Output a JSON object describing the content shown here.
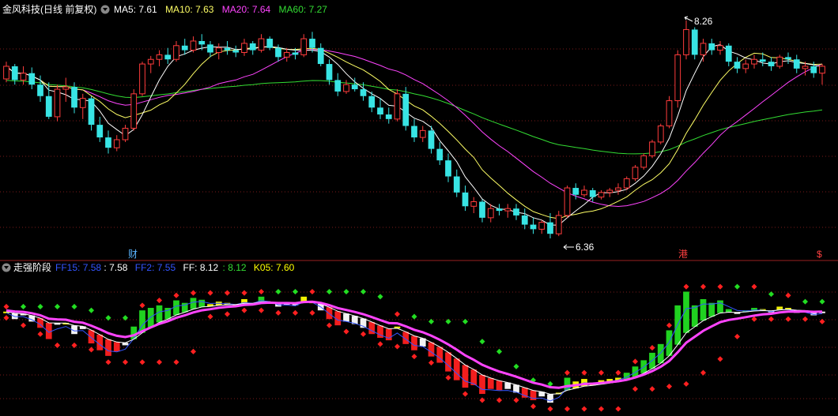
{
  "colors": {
    "bg": "#000000",
    "grid": "#7a1a1a",
    "up": "#ff3c3c",
    "down": "#38e4e4",
    "ma5": "#ffffff",
    "ma10": "#ffff66",
    "ma20": "#ff44ff",
    "ma60": "#33dd33",
    "title": "#ffffff",
    "ff15": "#3355ff",
    "ff2": "#3355ff",
    "ff": "#ffffff",
    "k05": "#ffff00"
  },
  "top_panel": {
    "title": "金风科技(日线 前复权)",
    "indicators": [
      {
        "name": "MA5",
        "sep": ": ",
        "value": "7.61",
        "color": "#ffffff"
      },
      {
        "name": "MA10",
        "sep": ": ",
        "value": "7.63",
        "color": "#ffff66"
      },
      {
        "name": "MA20",
        "sep": ": ",
        "value": "7.64",
        "color": "#ff44ff"
      },
      {
        "name": "MA60",
        "sep": ": ",
        "value": "7.27",
        "color": "#33dd33"
      }
    ],
    "high_label": "8.26",
    "low_label": "6.36",
    "markers": [
      "财",
      "港",
      "$"
    ]
  },
  "bottom_panel": {
    "title": "走强阶段",
    "indicators": [
      {
        "name": "FF15",
        "sep": ": ",
        "value": "7.58",
        "color": "#3355ff"
      },
      {
        "name": "",
        "sep": ": ",
        "value": "7.58",
        "color": "#ffffff"
      },
      {
        "name": "FF2",
        "sep": ": ",
        "value": "7.55",
        "color": "#3355ff"
      },
      {
        "name": "FF",
        "sep": ": ",
        "value": "8.12",
        "color": "#ffffff"
      },
      {
        "name": "",
        "sep": ": ",
        "value": "8.12",
        "color": "#33dd33"
      },
      {
        "name": "K05",
        "sep": ": ",
        "value": "7.60",
        "color": "#ffff00"
      }
    ]
  },
  "chart_data": {
    "type": "candlestick",
    "ylim": [
      6.25,
      8.3
    ],
    "candles": [
      [
        7.75,
        7.9,
        7.72,
        7.86
      ],
      [
        7.86,
        7.88,
        7.7,
        7.74
      ],
      [
        7.74,
        7.86,
        7.7,
        7.8
      ],
      [
        7.8,
        7.85,
        7.66,
        7.7
      ],
      [
        7.7,
        7.78,
        7.55,
        7.6
      ],
      [
        7.6,
        7.72,
        7.4,
        7.42
      ],
      [
        7.42,
        7.7,
        7.38,
        7.66
      ],
      [
        7.66,
        7.76,
        7.55,
        7.68
      ],
      [
        7.68,
        7.72,
        7.45,
        7.5
      ],
      [
        7.5,
        7.62,
        7.4,
        7.58
      ],
      [
        7.58,
        7.6,
        7.3,
        7.35
      ],
      [
        7.35,
        7.42,
        7.2,
        7.24
      ],
      [
        7.24,
        7.3,
        7.1,
        7.15
      ],
      [
        7.15,
        7.26,
        7.12,
        7.22
      ],
      [
        7.22,
        7.35,
        7.2,
        7.32
      ],
      [
        7.32,
        7.66,
        7.3,
        7.62
      ],
      [
        7.62,
        7.9,
        7.6,
        7.88
      ],
      [
        7.88,
        7.95,
        7.8,
        7.92
      ],
      [
        7.92,
        8.0,
        7.86,
        7.96
      ],
      [
        7.96,
        8.02,
        7.88,
        7.92
      ],
      [
        7.92,
        8.08,
        7.9,
        8.04
      ],
      [
        8.04,
        8.1,
        7.96,
        8.0
      ],
      [
        8.0,
        8.12,
        7.98,
        8.08
      ],
      [
        8.08,
        8.14,
        8.0,
        8.05
      ],
      [
        8.05,
        8.08,
        7.94,
        7.98
      ],
      [
        7.98,
        8.06,
        7.92,
        8.02
      ],
      [
        8.02,
        8.08,
        7.96,
        8.0
      ],
      [
        8.0,
        8.04,
        7.94,
        7.98
      ],
      [
        7.98,
        8.1,
        7.95,
        8.06
      ],
      [
        8.06,
        8.08,
        7.96,
        8.0
      ],
      [
        8.0,
        8.14,
        7.98,
        8.1
      ],
      [
        8.1,
        8.12,
        8.0,
        8.02
      ],
      [
        8.02,
        8.05,
        7.9,
        7.94
      ],
      [
        7.94,
        8.02,
        7.9,
        7.98
      ],
      [
        7.98,
        8.02,
        7.92,
        7.96
      ],
      [
        7.96,
        8.14,
        7.94,
        8.1
      ],
      [
        8.1,
        8.16,
        7.98,
        8.02
      ],
      [
        8.02,
        8.06,
        7.86,
        7.88
      ],
      [
        7.88,
        7.92,
        7.7,
        7.74
      ],
      [
        7.74,
        7.8,
        7.6,
        7.64
      ],
      [
        7.64,
        7.74,
        7.62,
        7.7
      ],
      [
        7.7,
        7.76,
        7.64,
        7.66
      ],
      [
        7.66,
        7.72,
        7.56,
        7.6
      ],
      [
        7.6,
        7.64,
        7.46,
        7.5
      ],
      [
        7.5,
        7.58,
        7.4,
        7.44
      ],
      [
        7.44,
        7.5,
        7.36,
        7.4
      ],
      [
        7.4,
        7.66,
        7.38,
        7.62
      ],
      [
        7.62,
        7.68,
        7.3,
        7.34
      ],
      [
        7.34,
        7.4,
        7.2,
        7.24
      ],
      [
        7.24,
        7.34,
        7.2,
        7.3
      ],
      [
        7.3,
        7.34,
        7.1,
        7.14
      ],
      [
        7.14,
        7.2,
        7.0,
        7.04
      ],
      [
        7.04,
        7.1,
        6.85,
        6.9
      ],
      [
        6.9,
        6.96,
        6.72,
        6.76
      ],
      [
        6.76,
        6.82,
        6.6,
        6.64
      ],
      [
        6.64,
        6.72,
        6.58,
        6.68
      ],
      [
        6.68,
        6.7,
        6.5,
        6.54
      ],
      [
        6.54,
        6.66,
        6.5,
        6.62
      ],
      [
        6.62,
        6.66,
        6.56,
        6.6
      ],
      [
        6.6,
        6.66,
        6.54,
        6.62
      ],
      [
        6.62,
        6.66,
        6.52,
        6.56
      ],
      [
        6.56,
        6.62,
        6.44,
        6.48
      ],
      [
        6.48,
        6.54,
        6.4,
        6.44
      ],
      [
        6.44,
        6.52,
        6.4,
        6.5
      ],
      [
        6.5,
        6.58,
        6.36,
        6.4
      ],
      [
        6.4,
        6.6,
        6.38,
        6.56
      ],
      [
        6.56,
        6.82,
        6.54,
        6.8
      ],
      [
        6.8,
        6.84,
        6.7,
        6.74
      ],
      [
        6.74,
        6.82,
        6.72,
        6.78
      ],
      [
        6.78,
        6.8,
        6.68,
        6.72
      ],
      [
        6.72,
        6.78,
        6.7,
        6.76
      ],
      [
        6.76,
        6.8,
        6.72,
        6.78
      ],
      [
        6.78,
        6.84,
        6.74,
        6.8
      ],
      [
        6.8,
        6.9,
        6.78,
        6.88
      ],
      [
        6.88,
        7.0,
        6.86,
        6.98
      ],
      [
        6.98,
        7.1,
        6.96,
        7.08
      ],
      [
        7.08,
        7.22,
        7.06,
        7.2
      ],
      [
        7.2,
        7.36,
        7.18,
        7.34
      ],
      [
        7.34,
        7.6,
        7.32,
        7.56
      ],
      [
        7.56,
        8.0,
        7.5,
        7.96
      ],
      [
        7.96,
        8.26,
        7.92,
        8.18
      ],
      [
        8.18,
        8.2,
        7.92,
        7.96
      ],
      [
        7.96,
        8.1,
        7.9,
        8.06
      ],
      [
        8.06,
        8.1,
        7.96,
        8.0
      ],
      [
        8.0,
        8.08,
        7.96,
        8.04
      ],
      [
        8.04,
        8.06,
        7.86,
        7.9
      ],
      [
        7.9,
        7.94,
        7.8,
        7.84
      ],
      [
        7.84,
        7.92,
        7.8,
        7.88
      ],
      [
        7.88,
        7.96,
        7.84,
        7.92
      ],
      [
        7.92,
        7.98,
        7.86,
        7.9
      ],
      [
        7.9,
        7.94,
        7.82,
        7.86
      ],
      [
        7.86,
        7.96,
        7.84,
        7.94
      ],
      [
        7.94,
        7.98,
        7.88,
        7.92
      ],
      [
        7.92,
        7.96,
        7.8,
        7.84
      ],
      [
        7.84,
        7.9,
        7.78,
        7.86
      ],
      [
        7.86,
        7.9,
        7.76,
        7.8
      ],
      [
        7.8,
        7.88,
        7.7,
        7.86
      ]
    ]
  }
}
